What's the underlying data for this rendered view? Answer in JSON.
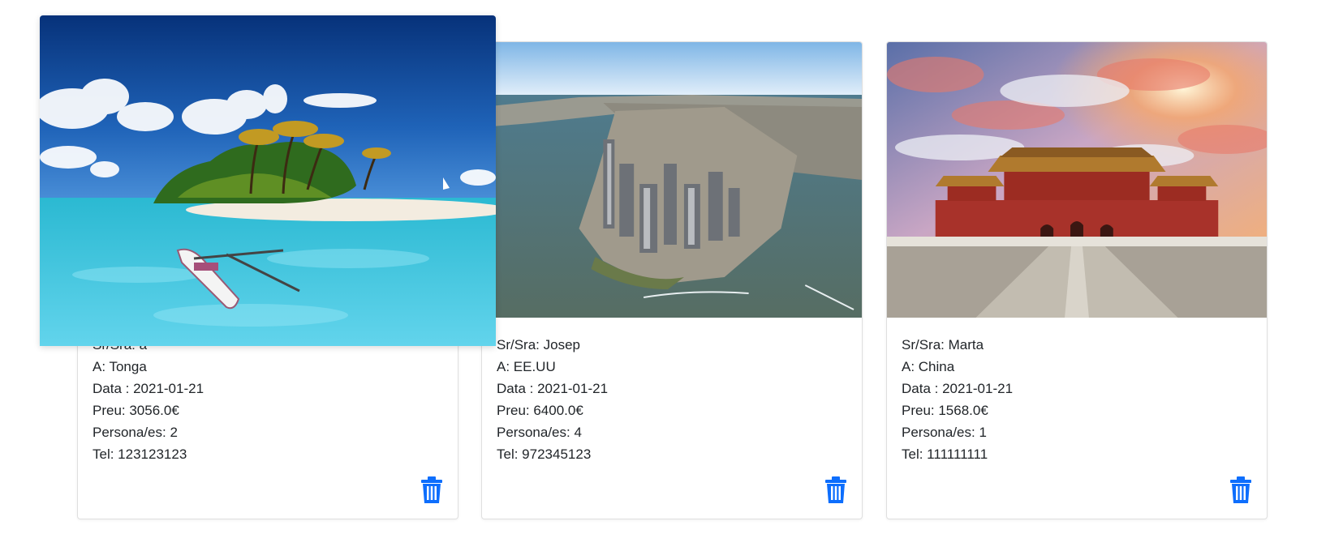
{
  "cards": [
    {
      "image": "tropical-island-photo",
      "client_label": "Sr/Sra: a",
      "destination_label": "A: Tonga",
      "date_label": "Data : 2021-01-21",
      "price_label": "Preu: 3056.0€",
      "persons_label": "Persona/es: 2",
      "phone_label": "Tel: 123123123",
      "delete_icon": "trash-icon"
    },
    {
      "image": "manhattan-aerial-photo",
      "client_label": "Sr/Sra: Josep",
      "destination_label": "A: EE.UU",
      "date_label": "Data : 2021-01-21",
      "price_label": "Preu: 6400.0€",
      "persons_label": "Persona/es: 4",
      "phone_label": "Tel: 972345123",
      "delete_icon": "trash-icon"
    },
    {
      "image": "forbidden-city-photo",
      "client_label": "Sr/Sra: Marta",
      "destination_label": "A: China",
      "date_label": "Data : 2021-01-21",
      "price_label": "Preu: 1568.0€",
      "persons_label": "Persona/es: 1",
      "phone_label": "Tel: 111111111",
      "delete_icon": "trash-icon"
    }
  ],
  "colors": {
    "accent": "#0d6efd",
    "text": "#212529",
    "card_border": "#dee2e6"
  }
}
